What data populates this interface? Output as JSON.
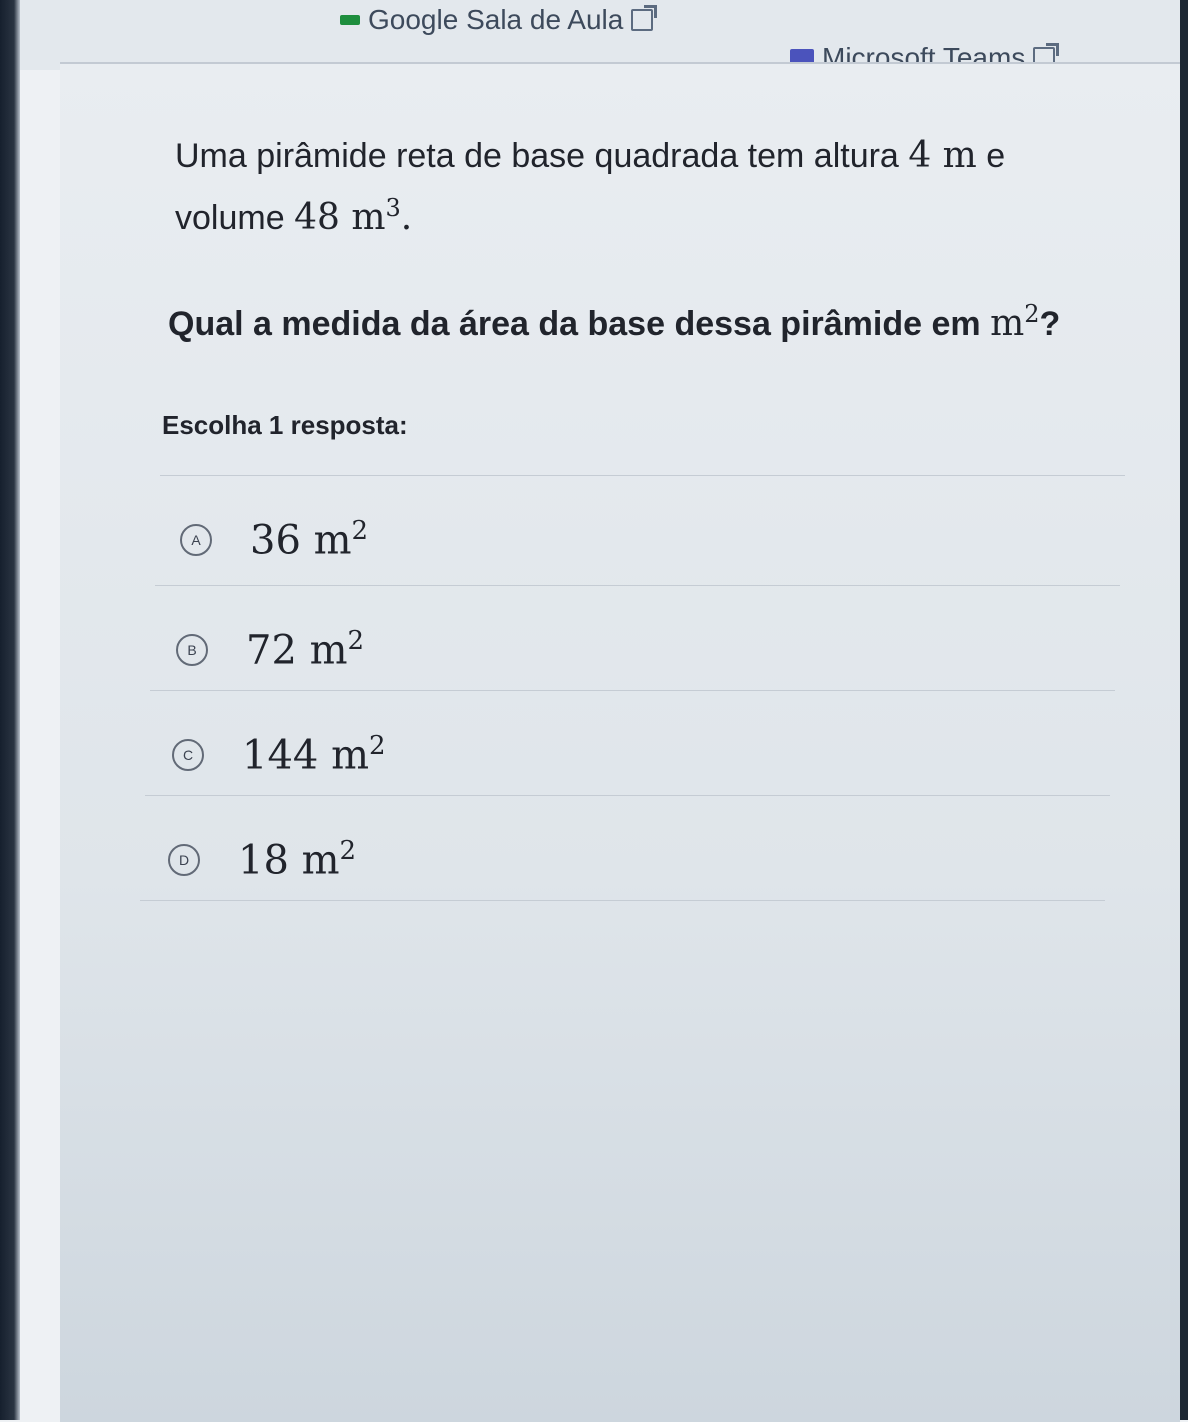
{
  "top_links": {
    "classroom_label": "Google Sala de Aula",
    "teams_label": "Microsoft Teams"
  },
  "question": {
    "line1": "Uma pirâmide reta de base quadrada tem altura",
    "height_value": "4 m",
    "conj": "e",
    "line2": "volume",
    "volume_value": "48 m",
    "volume_exp": "3",
    "volume_end": ".",
    "prompt": "Qual a medida da área da base dessa pirâmide em",
    "prompt_unit": "m",
    "prompt_exp": "2",
    "prompt_end": "?"
  },
  "instruction": "Escolha 1 resposta:",
  "choices": [
    {
      "letter": "A",
      "value": "36 m",
      "exp": "2"
    },
    {
      "letter": "B",
      "value": "72 m",
      "exp": "2"
    },
    {
      "letter": "C",
      "value": "144 m",
      "exp": "2"
    },
    {
      "letter": "D",
      "value": "18 m",
      "exp": "2"
    }
  ],
  "colors": {
    "text": "#21242c",
    "classroom": "#1e8e3e",
    "teams": "#4b53bc"
  }
}
